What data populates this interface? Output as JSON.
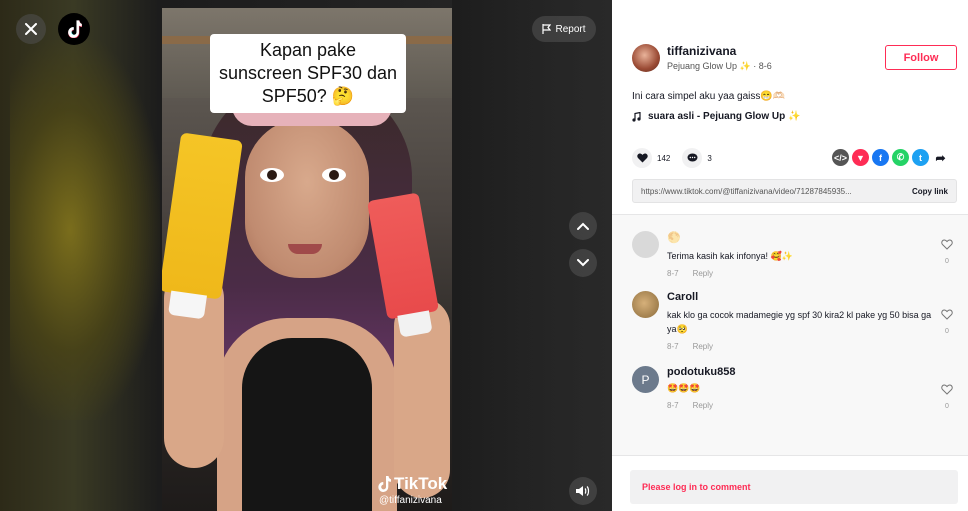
{
  "video": {
    "caption": "Kapan pake sunscreen SPF30 dan SPF50? 🤔",
    "watermark_brand": "TikTok",
    "watermark_user": "@tiffanizivana"
  },
  "controls": {
    "report_label": "Report"
  },
  "author": {
    "username": "tiffanizivana",
    "subtitle": "Pejuang Glow Up ✨ · 8-6",
    "follow_label": "Follow"
  },
  "post": {
    "description": "Ini cara simpel aku yaa gaiss😁🫶🏻",
    "music": "suara asli - Pejuang Glow Up ✨",
    "likes": "142",
    "comments": "3",
    "link": "https://www.tiktok.com/@tiffanizivana/video/71287845935...",
    "copy_link_label": "Copy link"
  },
  "share_icons": [
    {
      "name": "embed-icon",
      "color": "#555555"
    },
    {
      "name": "send-icon",
      "color": "#fe2c55"
    },
    {
      "name": "facebook-icon",
      "color": "#1877f2"
    },
    {
      "name": "whatsapp-icon",
      "color": "#25d366"
    },
    {
      "name": "twitter-icon",
      "color": "#1da1f2"
    },
    {
      "name": "more-share-icon",
      "color": "#161823"
    }
  ],
  "comments": [
    {
      "name": "🌕",
      "text": "Terima kasih kak infonya! 🥰✨",
      "date": "8-7",
      "reply": "Reply",
      "likes": "0"
    },
    {
      "name": "Caroll",
      "text": "kak klo ga cocok madamegie yg spf 30 kira2 kl pake yg 50 bisa ga ya🥺",
      "date": "8-7",
      "reply": "Reply",
      "likes": "0"
    },
    {
      "name": "podotuku858",
      "text": "🤩🤩🤩",
      "date": "8-7",
      "reply": "Reply",
      "likes": "0",
      "avatar_letter": "P"
    }
  ],
  "login_prompt": "Please log in to comment",
  "colors": {
    "accent": "#fe2c55",
    "text": "#161823"
  }
}
